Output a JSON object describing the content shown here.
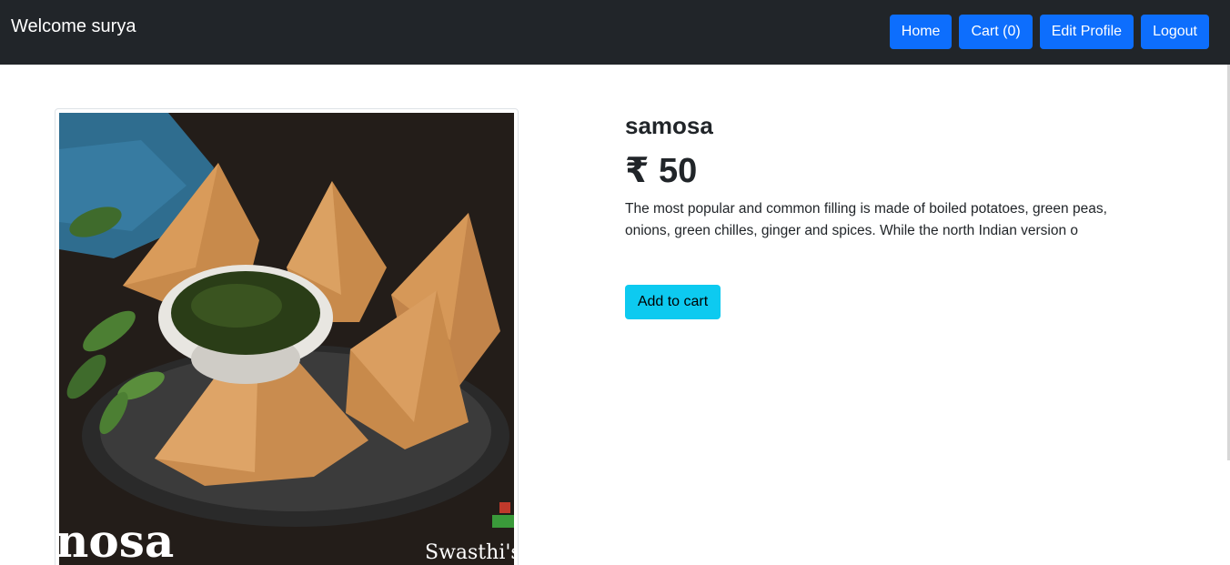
{
  "navbar": {
    "brand": "Welcome surya",
    "buttons": {
      "home": "Home",
      "cart": "Cart (0)",
      "edit_profile": "Edit Profile",
      "logout": "Logout"
    }
  },
  "product": {
    "image": {
      "caption_left": "nosa",
      "caption_right": "Swasthi's"
    },
    "name": "samosa",
    "price": "₹ 50",
    "description": "The most popular and common filling is made of boiled potatoes, green peas, onions, green chilles, ginger and spices. While the north Indian version o",
    "add_to_cart": "Add to cart"
  },
  "colors": {
    "navbar_bg": "#212529",
    "primary": "#0d6efd",
    "info": "#0dcaf0"
  }
}
